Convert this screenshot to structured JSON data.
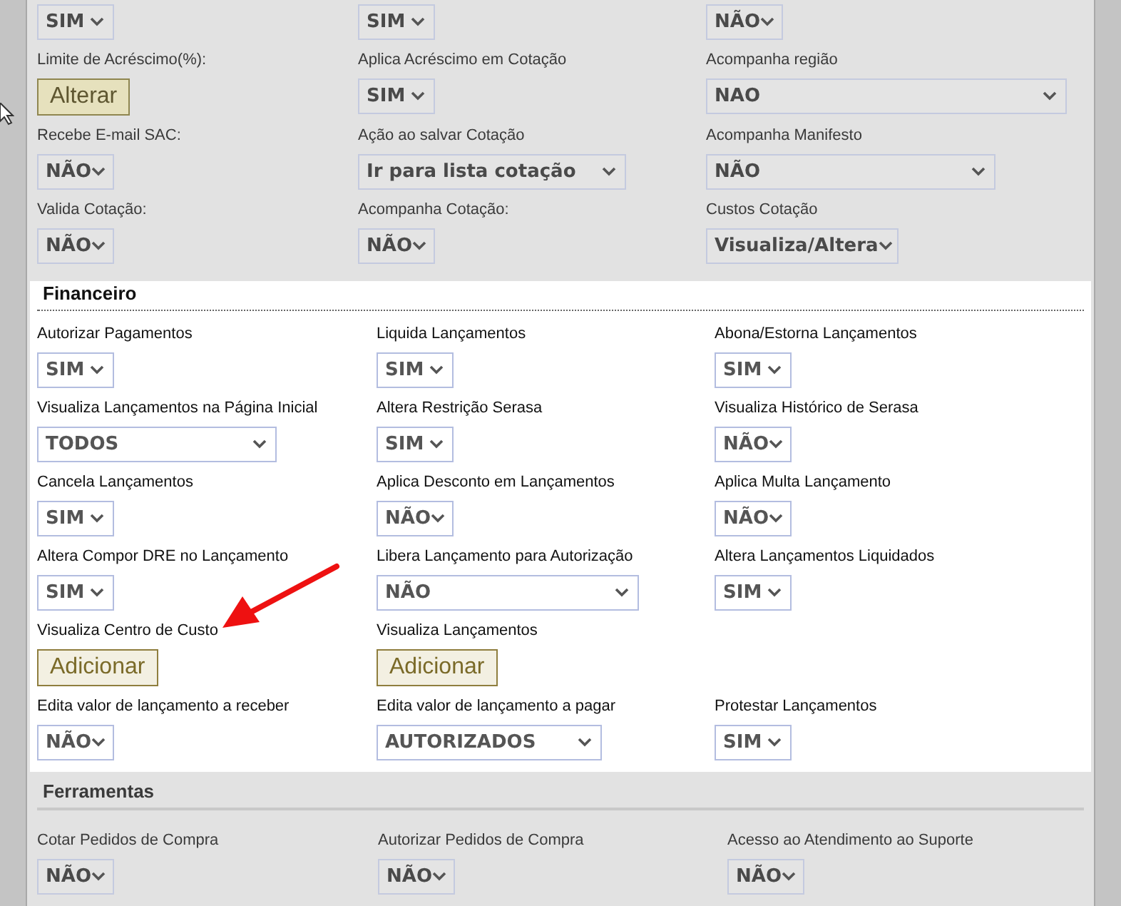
{
  "sections": [
    {
      "dimmed": true,
      "rows": [
        [
          {
            "kind": "select",
            "value": "SIM"
          },
          {
            "kind": "select",
            "value": "SIM"
          },
          {
            "kind": "select",
            "value": "NÃO"
          }
        ],
        [
          {
            "kind": "button",
            "label": "Limite de Acréscimo(%):",
            "value": "Alterar"
          },
          {
            "kind": "select",
            "label": "Aplica Acréscimo em Cotação",
            "value": "SIM"
          },
          {
            "kind": "select",
            "label": "Acompanha região",
            "value": "NAO"
          }
        ],
        [
          {
            "kind": "select",
            "label": "Recebe E-mail SAC:",
            "value": "NÃO"
          },
          {
            "kind": "select",
            "label": "Ação ao salvar Cotação",
            "value": "Ir para lista cotação"
          },
          {
            "kind": "select",
            "label": "Acompanha Manifesto",
            "value": "NÃO"
          }
        ],
        [
          {
            "kind": "select",
            "label": "Valida Cotação:",
            "value": "NÃO"
          },
          {
            "kind": "select",
            "label": "Acompanha Cotação:",
            "value": "NÃO"
          },
          {
            "kind": "select",
            "label": "Custos Cotação",
            "value": "Visualiza/Altera"
          }
        ]
      ]
    },
    {
      "dimmed": false,
      "title": "Financeiro",
      "rows": [
        [
          {
            "kind": "select",
            "label": "Autorizar Pagamentos",
            "value": "SIM"
          },
          {
            "kind": "select",
            "label": "Liquida Lançamentos",
            "value": "SIM"
          },
          {
            "kind": "select",
            "label": "Abona/Estorna Lançamentos",
            "value": "SIM"
          }
        ],
        [
          {
            "kind": "select",
            "label": "Visualiza Lançamentos na Página Inicial",
            "value": "TODOS"
          },
          {
            "kind": "select",
            "label": "Altera Restrição Serasa",
            "value": "SIM"
          },
          {
            "kind": "select",
            "label": "Visualiza Histórico de Serasa",
            "value": "NÃO"
          }
        ],
        [
          {
            "kind": "select",
            "label": "Cancela Lançamentos",
            "value": "SIM"
          },
          {
            "kind": "select",
            "label": "Aplica Desconto em Lançamentos",
            "value": "NÃO"
          },
          {
            "kind": "select",
            "label": "Aplica Multa Lançamento",
            "value": "NÃO"
          }
        ],
        [
          {
            "kind": "select",
            "label": "Altera Compor DRE no Lançamento",
            "value": "SIM"
          },
          {
            "kind": "select",
            "label": "Libera Lançamento para Autorização",
            "value": "NÃO"
          },
          {
            "kind": "select",
            "label": "Altera Lançamentos Liquidados",
            "value": "SIM"
          }
        ],
        [
          {
            "kind": "button",
            "label": "Visualiza Centro de Custo",
            "value": "Adicionar"
          },
          {
            "kind": "button",
            "label": "Visualiza Lançamentos",
            "value": "Adicionar"
          }
        ],
        [
          {
            "kind": "select",
            "label": "Edita valor de lançamento a receber",
            "value": "NÃO"
          },
          {
            "kind": "select",
            "label": "Edita valor de lançamento a pagar",
            "value": "AUTORIZADOS"
          },
          {
            "kind": "select",
            "label": "Protestar Lançamentos",
            "value": "SIM"
          }
        ]
      ]
    },
    {
      "dimmed": true,
      "title": "Ferramentas",
      "rows": [
        [
          {
            "kind": "select",
            "label": "Cotar Pedidos de Compra",
            "value": "NÃO"
          },
          {
            "kind": "select",
            "label": "Autorizar Pedidos de Compra",
            "value": "NÃO"
          },
          {
            "kind": "select",
            "label": "Acesso ao Atendimento ao Suporte",
            "value": "NÃO"
          }
        ]
      ]
    }
  ]
}
